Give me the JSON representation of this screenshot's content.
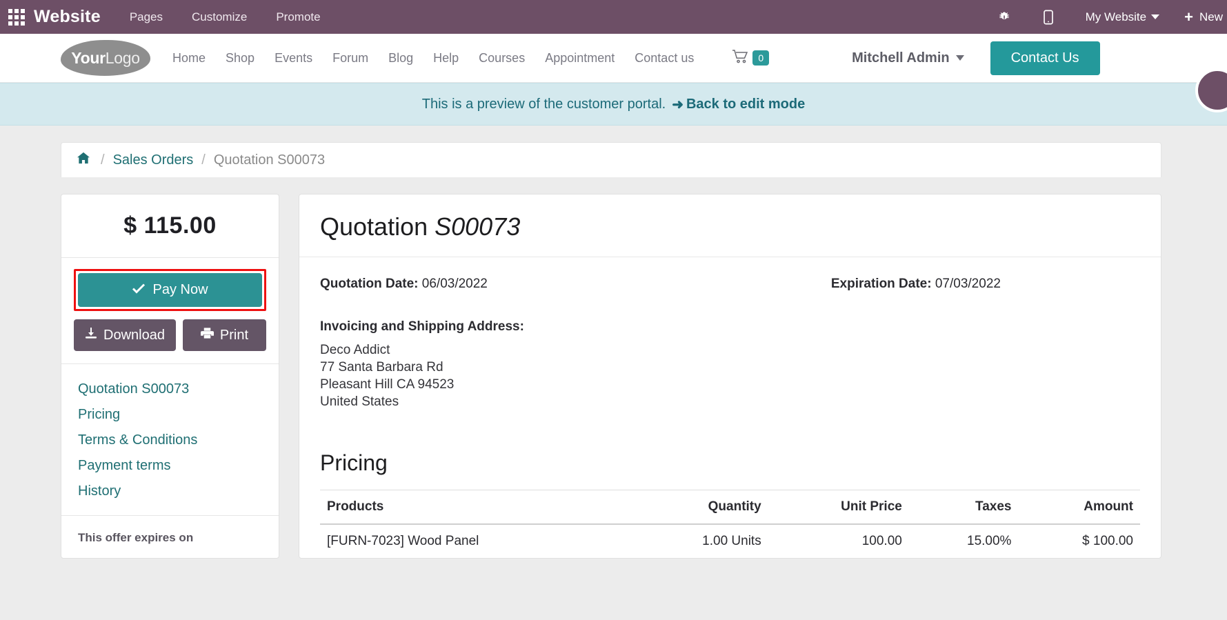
{
  "editor_bar": {
    "apps_icon": "apps-grid-icon",
    "brand": "Website",
    "menu": [
      "Pages",
      "Customize",
      "Promote"
    ],
    "bug_icon": "bug-icon",
    "mobile_icon": "mobile-preview-icon",
    "site_selector": "My Website",
    "new_label": "New",
    "plus_icon": "plus-icon",
    "background_color": "#6d4f66"
  },
  "site_nav": {
    "logo": {
      "bold": "Your",
      "light": "Logo"
    },
    "items": [
      "Home",
      "Shop",
      "Events",
      "Forum",
      "Blog",
      "Help",
      "Courses",
      "Appointment",
      "Contact us"
    ],
    "cart_icon": "shopping-cart-icon",
    "cart_count": "0",
    "cart_badge_color": "#2c9a9a",
    "user": "Mitchell Admin",
    "cta_label": "Contact Us",
    "cta_color": "#24999b",
    "drop_badge_icon": "odoo-drop-icon"
  },
  "preview_banner": {
    "text": "This is a preview of the customer portal.",
    "arrow_icon": "arrow-right-icon",
    "link": "Back to edit mode",
    "background_color": "#d4e9ee",
    "text_color": "#1c6a78"
  },
  "breadcrumb": {
    "home_icon": "home-icon",
    "separator": "/",
    "link": "Sales Orders",
    "current": "Quotation S00073"
  },
  "sidebar": {
    "amount": "$ 115.00",
    "pay_now": {
      "label": "Pay Now",
      "icon": "check-icon",
      "color": "#2c9294",
      "highlight_color": "#ee1111"
    },
    "download": {
      "label": "Download",
      "icon": "download-icon"
    },
    "print": {
      "label": "Print",
      "icon": "printer-icon"
    },
    "links": [
      "Quotation S00073",
      "Pricing",
      "Terms & Conditions",
      "Payment terms",
      "History"
    ],
    "expire_note": "This offer expires on"
  },
  "main": {
    "title_prefix": "Quotation ",
    "title_ref": "S00073",
    "quotation_date_label": "Quotation Date:",
    "quotation_date": "06/03/2022",
    "expiration_date_label": "Expiration Date:",
    "expiration_date": "07/03/2022",
    "address_label": "Invoicing and Shipping Address:",
    "address_lines": [
      "Deco Addict",
      "77 Santa Barbara Rd",
      "Pleasant Hill CA 94523",
      "United States"
    ],
    "pricing_heading": "Pricing",
    "table": {
      "columns": [
        "Products",
        "Quantity",
        "Unit Price",
        "Taxes",
        "Amount"
      ],
      "rows": [
        [
          "[FURN-7023] Wood Panel",
          "1.00 Units",
          "100.00",
          "15.00%",
          "$ 100.00"
        ]
      ]
    }
  }
}
